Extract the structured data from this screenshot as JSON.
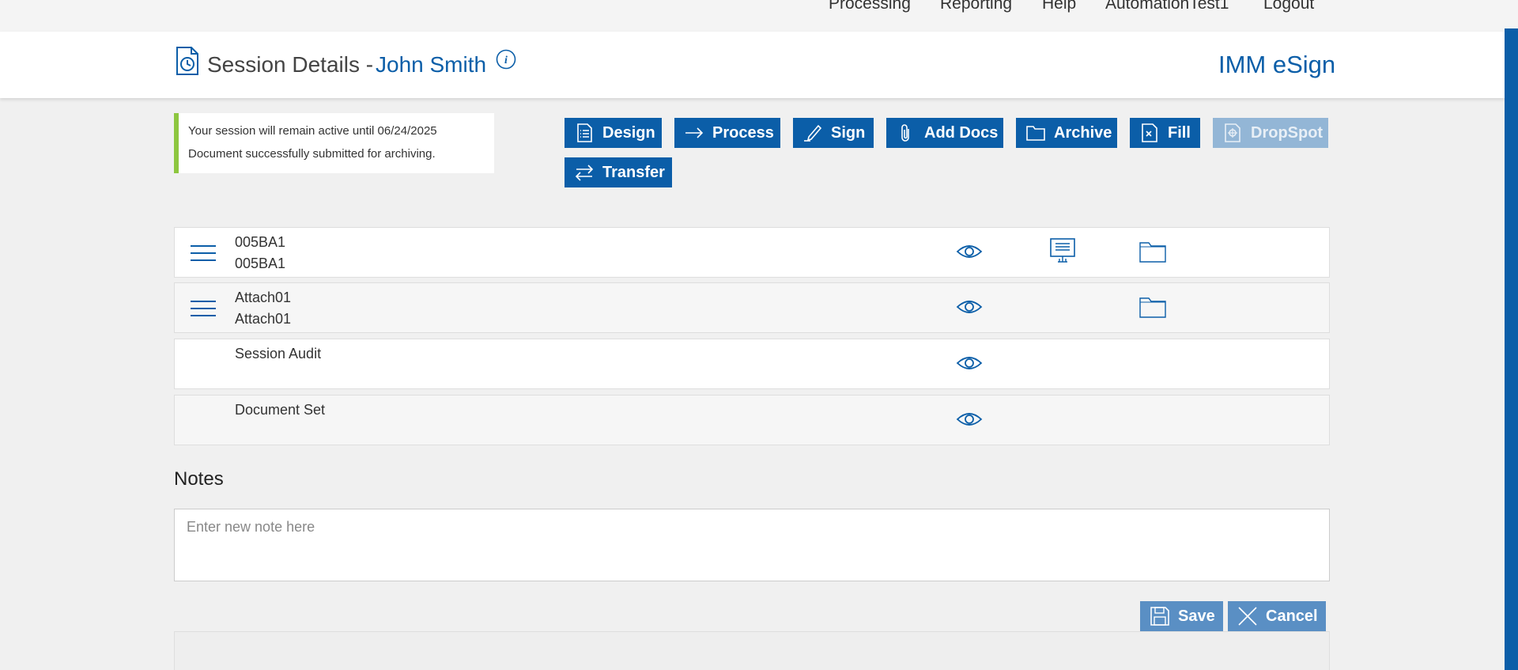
{
  "topnav": {
    "items": [
      "Processing",
      "Reporting",
      "Help",
      "AutomationTest1",
      "Logout"
    ]
  },
  "header": {
    "title": "Session Details -",
    "user": "John Smith",
    "brand": "IMM eSign"
  },
  "messages": [
    "Your session will remain active until 06/24/2025",
    "Document successfully submitted for archiving."
  ],
  "toolbar": {
    "design": "Design",
    "process": "Process",
    "sign": "Sign",
    "add_docs": "Add Docs",
    "archive": "Archive",
    "fill": "Fill",
    "dropspot": "DropSpot",
    "transfer": "Transfer"
  },
  "documents": [
    {
      "line1": "005BA1",
      "line2": "005BA1"
    },
    {
      "line1": "Attach01",
      "line2": "Attach01"
    },
    {
      "line1": "Session Audit"
    },
    {
      "line1": "Document Set"
    }
  ],
  "notes": {
    "title": "Notes",
    "placeholder": "Enter new note here",
    "save_label": "Save",
    "cancel_label": "Cancel"
  },
  "colors": {
    "primary": "#0b5ea8",
    "disabled": "#93b6d6",
    "success_bar": "#8dc63f"
  }
}
